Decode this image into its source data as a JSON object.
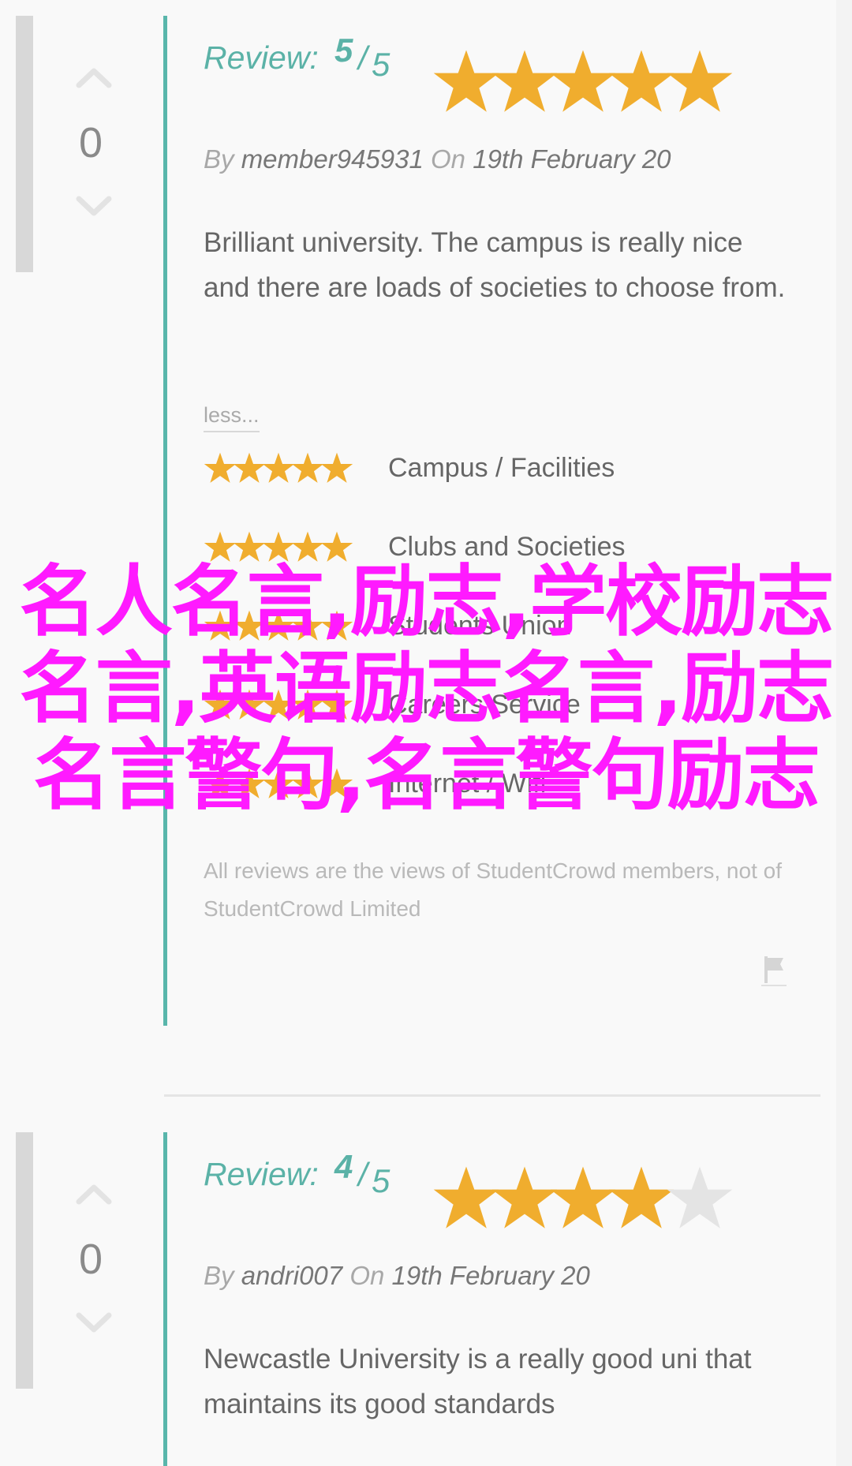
{
  "colors": {
    "accent": "#5bb2a7",
    "star_on": "#f0ad2e",
    "star_off": "#e4e4e4",
    "overlay": "#ff1aff"
  },
  "reviews": [
    {
      "votes": "0",
      "review_label": "Review:",
      "score": "5",
      "slash": "/",
      "out_of": "5",
      "stars_filled": 5,
      "by_label": "By",
      "author": "member945931",
      "on_label": "On",
      "date": "19th February 20",
      "body": "Brilliant university. The campus is really nice and there are loads of societies to choose from.",
      "less_label": "less...",
      "categories": [
        {
          "label": "Campus / Facilities",
          "stars_filled": 5
        },
        {
          "label": "Clubs and Societies",
          "stars_filled": 5
        },
        {
          "label": "Students Union",
          "stars_filled": 5
        },
        {
          "label": "Careers Service",
          "stars_filled": 5
        },
        {
          "label": "Internet / Wifi",
          "stars_filled": 5
        }
      ],
      "disclaimer": "All reviews are the views of StudentCrowd members, not of StudentCrowd Limited"
    },
    {
      "votes": "0",
      "review_label": "Review:",
      "score": "4",
      "slash": "/",
      "out_of": "5",
      "stars_filled": 4,
      "by_label": "By",
      "author": "andri007",
      "on_label": "On",
      "date": "19th February 20",
      "body": "Newcastle University is a really good uni that maintains its good standards"
    }
  ],
  "overlay": {
    "text": "名人名言,励志,学校励志名言,英语励志名言,励志名言警句,名言警句励志"
  },
  "icons": {
    "vote_up": "chevron-up-icon",
    "vote_down": "chevron-down-icon",
    "star": "star-icon",
    "flag": "flag-icon"
  }
}
